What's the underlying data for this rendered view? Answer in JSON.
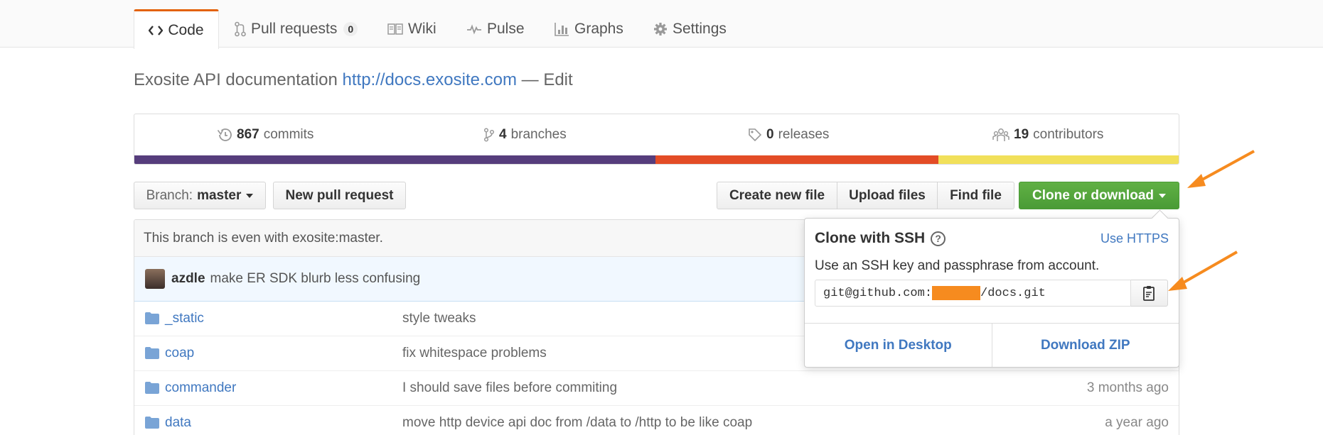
{
  "tabs": {
    "code": "Code",
    "pull_requests": "Pull requests",
    "pull_requests_count": "0",
    "wiki": "Wiki",
    "pulse": "Pulse",
    "graphs": "Graphs",
    "settings": "Settings"
  },
  "repo": {
    "description": "Exosite API documentation",
    "url": "http://docs.exosite.com",
    "edit_sep": "—",
    "edit": "Edit"
  },
  "summary": {
    "commits_count": "867",
    "commits_label": "commits",
    "branches_count": "4",
    "branches_label": "branches",
    "releases_count": "0",
    "releases_label": "releases",
    "contributors_count": "19",
    "contributors_label": "contributors",
    "language_colors": [
      "#563d7c",
      "#e34c26",
      "#f1e05a"
    ],
    "language_shares": [
      0.499,
      0.271,
      0.23
    ]
  },
  "toolbar": {
    "branch_prefix": "Branch:",
    "branch_name": "master",
    "new_pull_request": "New pull request",
    "create_new_file": "Create new file",
    "upload_files": "Upload files",
    "find_file": "Find file",
    "clone_or_download": "Clone or download"
  },
  "branch_status": "This branch is even with exosite:master.",
  "latest_commit": {
    "author": "azdle",
    "message": "make ER SDK blurb less confusing"
  },
  "files": [
    {
      "name": "_static",
      "message": "style tweaks",
      "age": ""
    },
    {
      "name": "coap",
      "message": "fix whitespace problems",
      "age": ""
    },
    {
      "name": "commander",
      "message": "I should save files before commiting",
      "age": "3 months ago"
    },
    {
      "name": "data",
      "message": "move http device api doc from /data to /http to be like coap",
      "age": "a year ago"
    }
  ],
  "clone_popover": {
    "title": "Clone with SSH",
    "help_glyph": "?",
    "use_https": "Use HTTPS",
    "description": "Use an SSH key and passphrase from account.",
    "url_prefix": "git@github.com:",
    "url_suffix": "/docs.git",
    "open_desktop": "Open in Desktop",
    "download_zip": "Download ZIP"
  },
  "colors": {
    "link": "#4078c0",
    "clone_button": "#55a532",
    "selected_tab_accent": "#e36209",
    "annotation_arrow": "#f68b1f",
    "redaction": "#f68b1f"
  },
  "icons": [
    "code-icon",
    "pull-request-icon",
    "book-icon",
    "pulse-icon",
    "graph-icon",
    "gear-icon",
    "history-icon",
    "branch-icon",
    "tag-icon",
    "organization-icon",
    "folder-icon",
    "clipboard-icon",
    "question-icon"
  ]
}
